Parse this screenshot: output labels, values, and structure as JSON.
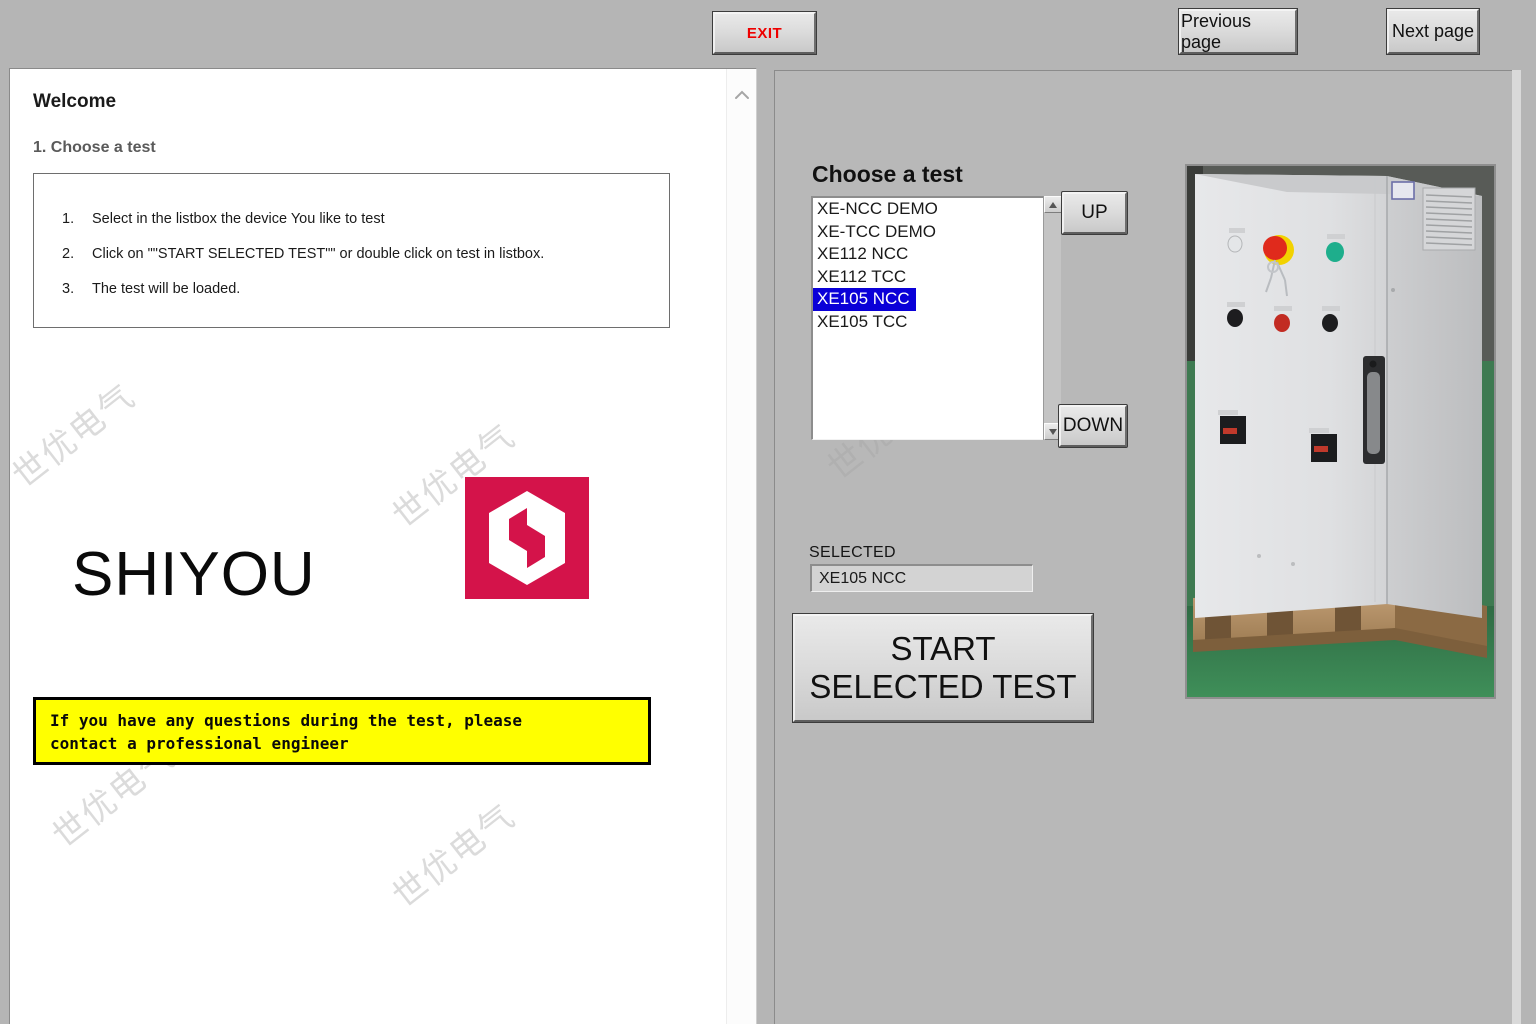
{
  "toolbar": {
    "exit_label": "EXIT",
    "exit_color": "#ee0000",
    "previous_page_label": "Previous page",
    "next_page_label": "Next page"
  },
  "document": {
    "welcome_heading": "Welcome",
    "section_heading": "1. Choose a test",
    "instructions": [
      {
        "num": "1.",
        "text": "Select in the listbox the device You like to test"
      },
      {
        "num": "2.",
        "text": "Click on \"\"START SELECTED TEST\"\" or double click on test in listbox."
      },
      {
        "num": "3.",
        "text": "The test will be loaded."
      }
    ],
    "brand_wordmark": "SHIYOU",
    "brand_logo_color": "#d4134a",
    "notice_text": "If you have any questions during the test, please\ncontact a professional engineer",
    "notice_background": "#ffff00",
    "watermark_text": "世优电气"
  },
  "control_panel": {
    "choose_test_label": "Choose a test",
    "test_list": [
      "XE-NCC DEMO",
      "XE-TCC DEMO",
      "XE112 NCC",
      "XE112 TCC",
      "XE105 NCC",
      "XE105 TCC"
    ],
    "selected_index": 4,
    "selection_highlight_color": "#0a00d8",
    "up_button_label": "UP",
    "down_button_label": "DOWN",
    "selected_label": "SELECTED",
    "selected_value": "XE105 NCC",
    "start_button_label": "START SELECTED TEST"
  }
}
